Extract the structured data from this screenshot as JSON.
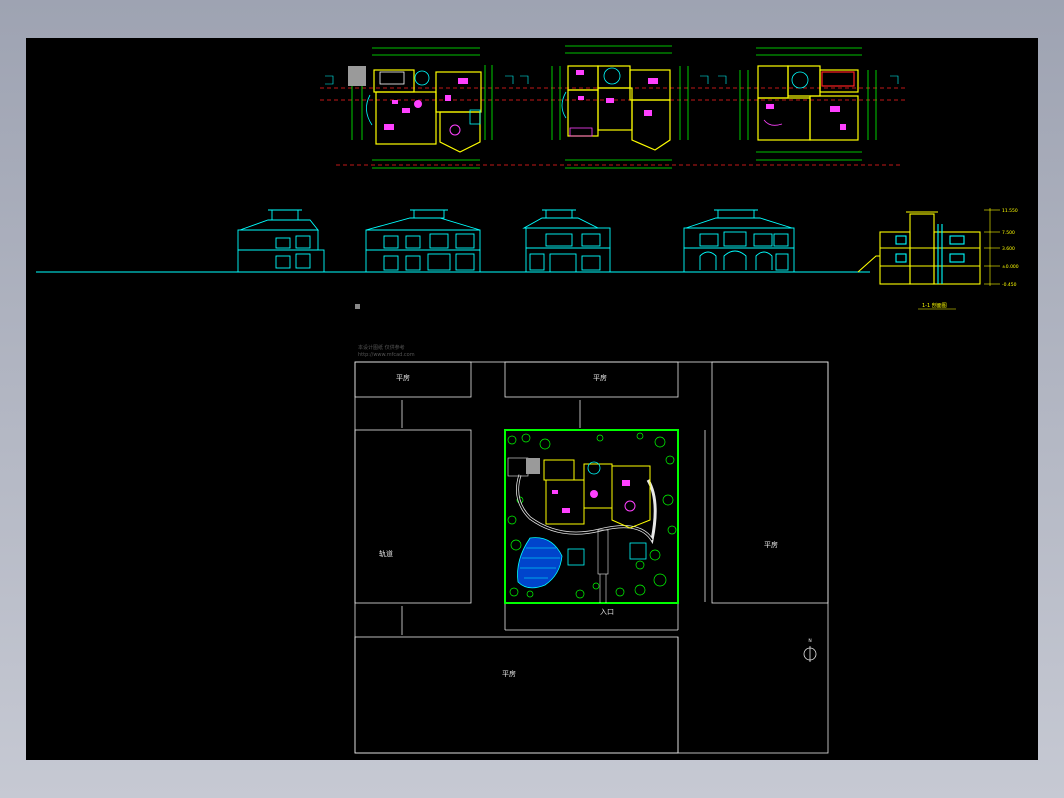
{
  "drawing": {
    "site_labels": {
      "top_left_block": "平房",
      "top_mid_block": "平房",
      "left_block": "轨道",
      "right_block": "平房",
      "bottom_block": "平房",
      "south_gate": "入口",
      "north_mark": "N"
    },
    "credit_line1": "本设计图纸 仅供参考",
    "credit_line2": "http://www.mfcad.com",
    "section_title": "1-1 剖面图",
    "level_marks": [
      "11.550",
      "7.500",
      "3.600",
      "±0.000",
      "-0.450"
    ],
    "colors": {
      "background": "#000000",
      "frame": "#b8bcc8",
      "cyan": "#00ffff",
      "yellow": "#ffff00",
      "green": "#00ff00",
      "red": "#ff2020",
      "magenta": "#ff40ff",
      "white": "#e8e8e8"
    }
  }
}
